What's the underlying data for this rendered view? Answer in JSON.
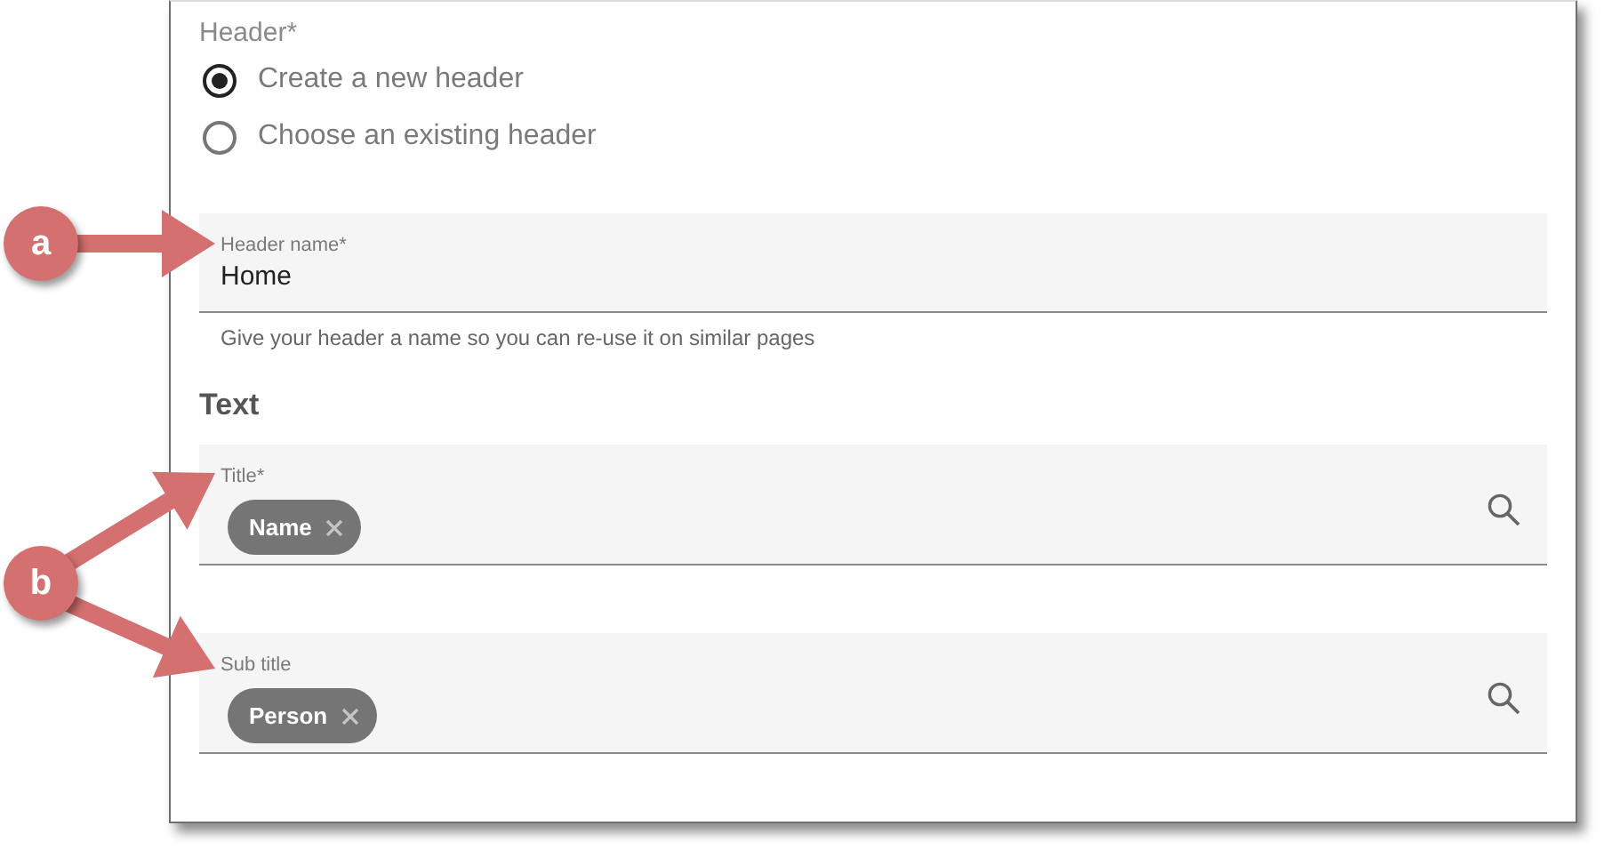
{
  "header_group": {
    "label": "Header*",
    "options": [
      {
        "label": "Create a new header",
        "selected": true
      },
      {
        "label": "Choose an existing header",
        "selected": false
      }
    ]
  },
  "header_name": {
    "label": "Header name*",
    "value": "Home",
    "helper": "Give your header a name so you can re-use it on similar pages"
  },
  "section_title": "Text",
  "chip_fields": [
    {
      "label": "Title*",
      "chips": [
        "Name"
      ]
    },
    {
      "label": "Sub title",
      "chips": [
        "Person"
      ]
    }
  ],
  "callouts": [
    {
      "label": "a"
    },
    {
      "label": "b"
    }
  ]
}
